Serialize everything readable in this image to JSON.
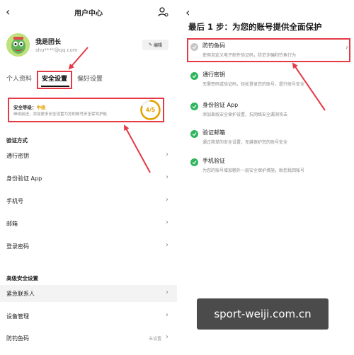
{
  "left": {
    "header": {
      "title": "用户中心"
    },
    "profile": {
      "name": "我是团长",
      "email": "shu****@qq.com",
      "edit_label": "编辑"
    },
    "tabs": [
      {
        "label": "个人资料",
        "active": false
      },
      {
        "label": "安全设置",
        "active": true
      },
      {
        "label": "偏好设置",
        "active": false
      }
    ],
    "security": {
      "level_prefix": "安全等级：",
      "level": "中级",
      "tip": "继续前进，添加更多安全设置为您的账号安全保驾护航",
      "score": "4/5",
      "score_fraction": 0.8
    },
    "verify_section": {
      "title": "验证方式",
      "items": [
        {
          "label": "通行密钥"
        },
        {
          "label": "身份验证 App"
        },
        {
          "label": "手机号"
        },
        {
          "label": "邮箱"
        },
        {
          "label": "登录密码"
        }
      ]
    },
    "advanced_section": {
      "title": "高级安全设置",
      "items": [
        {
          "label": "紧急联系人"
        },
        {
          "label": "设备管理"
        },
        {
          "label": "防钓鱼码",
          "value": "未设置"
        }
      ]
    }
  },
  "right": {
    "title": "最后 1 步：为您的账号提供全面保护",
    "options": [
      {
        "title": "防钓鱼码",
        "desc": "使用自定义电子邮件验证码，防范诈骗和钓鱼行为",
        "done": false
      },
      {
        "title": "通行密钥",
        "desc": "无需密码或验证码，轻松登录您的账号，提升账号安全",
        "done": true
      },
      {
        "title": "身份验证 App",
        "desc": "添加离线安全保护设置，抗网络安全漏洞攻击",
        "done": true
      },
      {
        "title": "验证邮箱",
        "desc": "通过简单的安全设置，无缝保护您的账号安全",
        "done": true
      },
      {
        "title": "手机验证",
        "desc": "为您的账号增加额外一层安全保护措施，助您找回账号",
        "done": true
      }
    ]
  },
  "watermark": "sport-weiji.com.cn",
  "colors": {
    "highlight": "#e53946",
    "check": "#2fb55e",
    "level": "#e5a100"
  }
}
